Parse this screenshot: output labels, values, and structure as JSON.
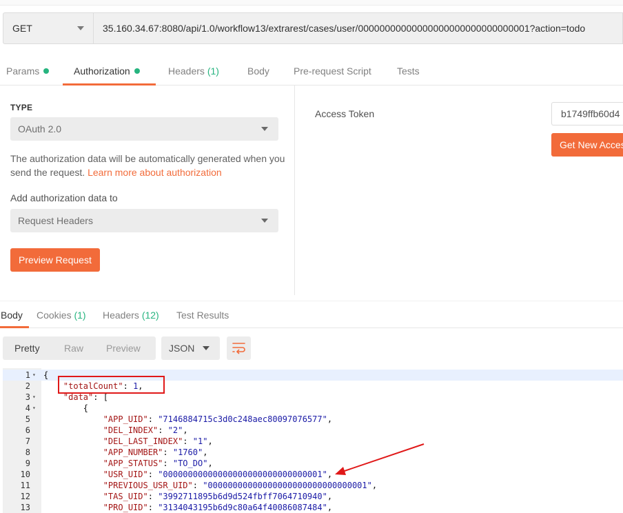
{
  "request": {
    "method": "GET",
    "url": "35.160.34.67:8080/api/1.0/workflow13/extrarest/cases/user/00000000000000000000000000000001?action=todo"
  },
  "request_tabs": [
    {
      "label": "Params",
      "count": "",
      "dot": true
    },
    {
      "label": "Authorization",
      "count": "",
      "dot": true,
      "active": true
    },
    {
      "label": "Headers",
      "count": "(1)",
      "dot": false
    },
    {
      "label": "Body",
      "count": "",
      "dot": false
    },
    {
      "label": "Pre-request Script",
      "count": "",
      "dot": false
    },
    {
      "label": "Tests",
      "count": "",
      "dot": false
    }
  ],
  "auth": {
    "type_label": "TYPE",
    "type_value": "OAuth 2.0",
    "description": "The authorization data will be automatically generated when you send the request.",
    "learn_more": "Learn more about authorization",
    "add_to_label": "Add authorization data to",
    "add_to_value": "Request Headers",
    "preview_button": "Preview Request",
    "access_token_label": "Access Token",
    "access_token_value": "b1749ffb60d4",
    "get_token_button": "Get New Access"
  },
  "response_tabs": [
    {
      "label": "Body",
      "count": "",
      "active": true
    },
    {
      "label": "Cookies",
      "count": "(1)"
    },
    {
      "label": "Headers",
      "count": "(12)"
    },
    {
      "label": "Test Results",
      "count": ""
    }
  ],
  "toolbar": {
    "view_modes": [
      "Pretty",
      "Raw",
      "Preview"
    ],
    "active_mode": "Pretty",
    "format": "JSON"
  },
  "code_lines": [
    {
      "n": "1",
      "fold": true,
      "text": "{"
    },
    {
      "n": "2",
      "fold": false,
      "text": "    \"totalCount\": 1,"
    },
    {
      "n": "3",
      "fold": true,
      "text": "    \"data\": ["
    },
    {
      "n": "4",
      "fold": true,
      "text": "        {"
    },
    {
      "n": "5",
      "fold": false,
      "text": "            \"APP_UID\": \"7146884715c3d0c248aec80097076577\","
    },
    {
      "n": "6",
      "fold": false,
      "text": "            \"DEL_INDEX\": \"2\","
    },
    {
      "n": "7",
      "fold": false,
      "text": "            \"DEL_LAST_INDEX\": \"1\","
    },
    {
      "n": "8",
      "fold": false,
      "text": "            \"APP_NUMBER\": \"1760\","
    },
    {
      "n": "9",
      "fold": false,
      "text": "            \"APP_STATUS\": \"TO_DO\","
    },
    {
      "n": "10",
      "fold": false,
      "text": "            \"USR_UID\": \"00000000000000000000000000000001\","
    },
    {
      "n": "11",
      "fold": false,
      "text": "            \"PREVIOUS_USR_UID\": \"00000000000000000000000000000001\","
    },
    {
      "n": "12",
      "fold": false,
      "text": "            \"TAS_UID\": \"3992711895b6d9d524fbff7064710940\","
    },
    {
      "n": "13",
      "fold": false,
      "text": "            \"PRO_UID\": \"3134043195b6d9c80a64f40086087484\","
    }
  ],
  "colors": {
    "accent": "#f26b3a",
    "count_green": "#26b47f",
    "annotation_red": "#e01818"
  }
}
